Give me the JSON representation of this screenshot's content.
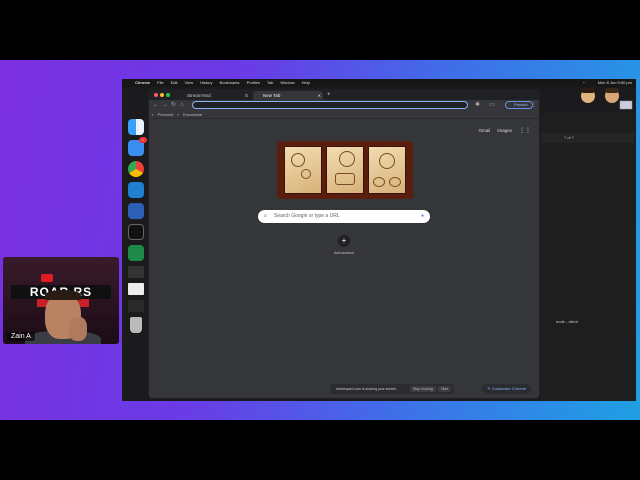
{
  "menubar": {
    "app_name": "Chrome",
    "items": [
      "File",
      "Edit",
      "View",
      "History",
      "Bookmarks",
      "Profiles",
      "Tab",
      "Window",
      "Help"
    ],
    "clock": "Mon 8 Jun  9:50 pm"
  },
  "webcam": {
    "name": "Zain A",
    "banner_text": "ROAR   RS",
    "banner_sub": "BUILL"
  },
  "browser": {
    "tabs": [
      {
        "label": "StreamYard",
        "active": false
      },
      {
        "label": "S",
        "active": false
      },
      {
        "label": "New Tab",
        "active": true
      }
    ],
    "new_tab_symbol": "+",
    "paused_label": "Paused",
    "bookmarks": [
      "Personal",
      "Encodable"
    ],
    "ntp": {
      "gmail": "Gmail",
      "images": "Images",
      "search_placeholder": "Search Google or type a URL",
      "shortcut_label": "Add shortcut",
      "share_text": "streamyard.com is sharing your screen.",
      "stop_sharing": "Stop sharing",
      "hide": "Hide",
      "customize": "Customize Chrome"
    }
  },
  "sidebar": {
    "find_count": "? of ?",
    "terminal_label": "node - client"
  },
  "colors": {
    "bg_start": "#7b2fe0",
    "bg_end": "#1fa0e4",
    "chrome_dark": "#35363a",
    "accent": "#8ab4f8"
  }
}
